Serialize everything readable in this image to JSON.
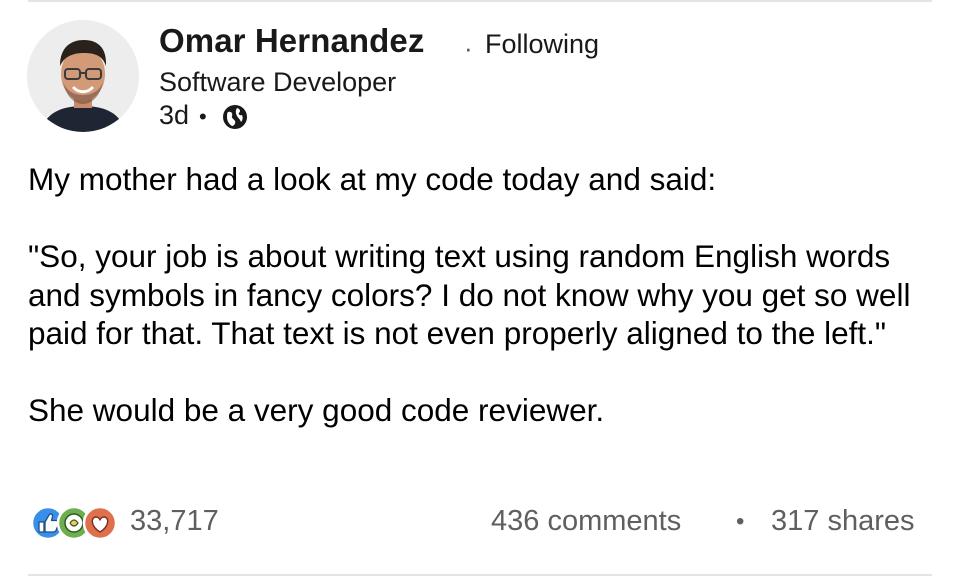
{
  "post": {
    "author": {
      "name": "Omar Hernandez",
      "follow_status": "Following",
      "headline": "Software Developer",
      "age": "3d",
      "visibility_icon": "globe-icon"
    },
    "body": {
      "paragraphs": [
        "My mother had a look at my code today and said:",
        "\"So, your job is about writing text using random English words and symbols in fancy colors? I do not know why you get so well paid for that. That text is not even properly aligned to the left.\"",
        "She would be a very good code reviewer."
      ]
    },
    "social": {
      "reaction_icons": [
        "like-icon",
        "celebrate-icon",
        "love-icon"
      ],
      "reaction_count": "33,717",
      "comments": "436 comments",
      "shares": "317 shares"
    }
  },
  "colors": {
    "like": "#378fe9",
    "celebrate": "#44712e",
    "love": "#df704d",
    "text_muted": "#5f5f5f"
  }
}
